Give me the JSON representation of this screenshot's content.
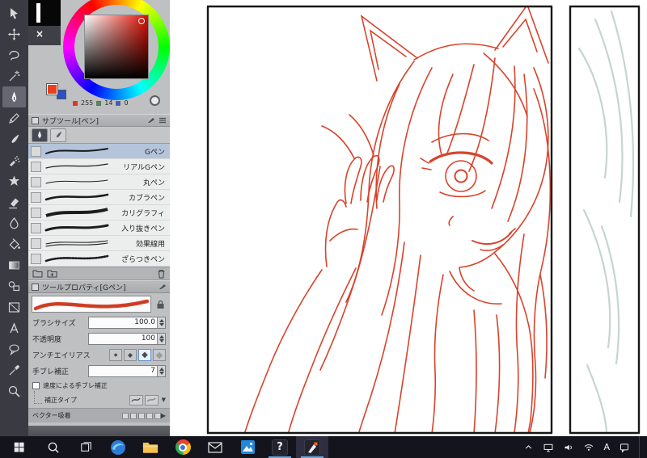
{
  "glyphs": {
    "close": "×",
    "diamond": "◆",
    "play": "▶",
    "down": "▼",
    "question": "?"
  },
  "color_panel": {
    "rgb": {
      "r": "255",
      "g": "14",
      "b": "0"
    },
    "foreground": "#e8401c",
    "background": "#2a50c8"
  },
  "subtool": {
    "title": "サブツール[ペン]",
    "items": [
      {
        "label": "Gペン",
        "selected": true
      },
      {
        "label": "リアルGペン",
        "selected": false
      },
      {
        "label": "丸ペン",
        "selected": false
      },
      {
        "label": "カブラペン",
        "selected": false
      },
      {
        "label": "カリグラフィ",
        "selected": false
      },
      {
        "label": "入り抜きペン",
        "selected": false
      },
      {
        "label": "効果線用",
        "selected": false
      },
      {
        "label": "ざらつきペン",
        "selected": false
      }
    ]
  },
  "tool_property": {
    "title": "ツールプロパティ[Gペン]",
    "brush_size": {
      "label": "ブラシサイズ",
      "value": "100.0"
    },
    "opacity": {
      "label": "不透明度",
      "value": "100"
    },
    "antialias": {
      "label": "アンチエイリアス"
    },
    "stabilization": {
      "label": "手ブレ補正",
      "value": "7"
    },
    "speed_stabilization": {
      "label": "速度による手ブレ補正"
    },
    "correction_type": {
      "label": "補正タイプ"
    },
    "vector_snap": {
      "label": "ベクター吸着"
    }
  },
  "colors": {
    "line_art": "#d8432b",
    "selection": "#b4c4db",
    "taskbar": "#14141d"
  },
  "taskbar": {
    "ime": "A"
  }
}
